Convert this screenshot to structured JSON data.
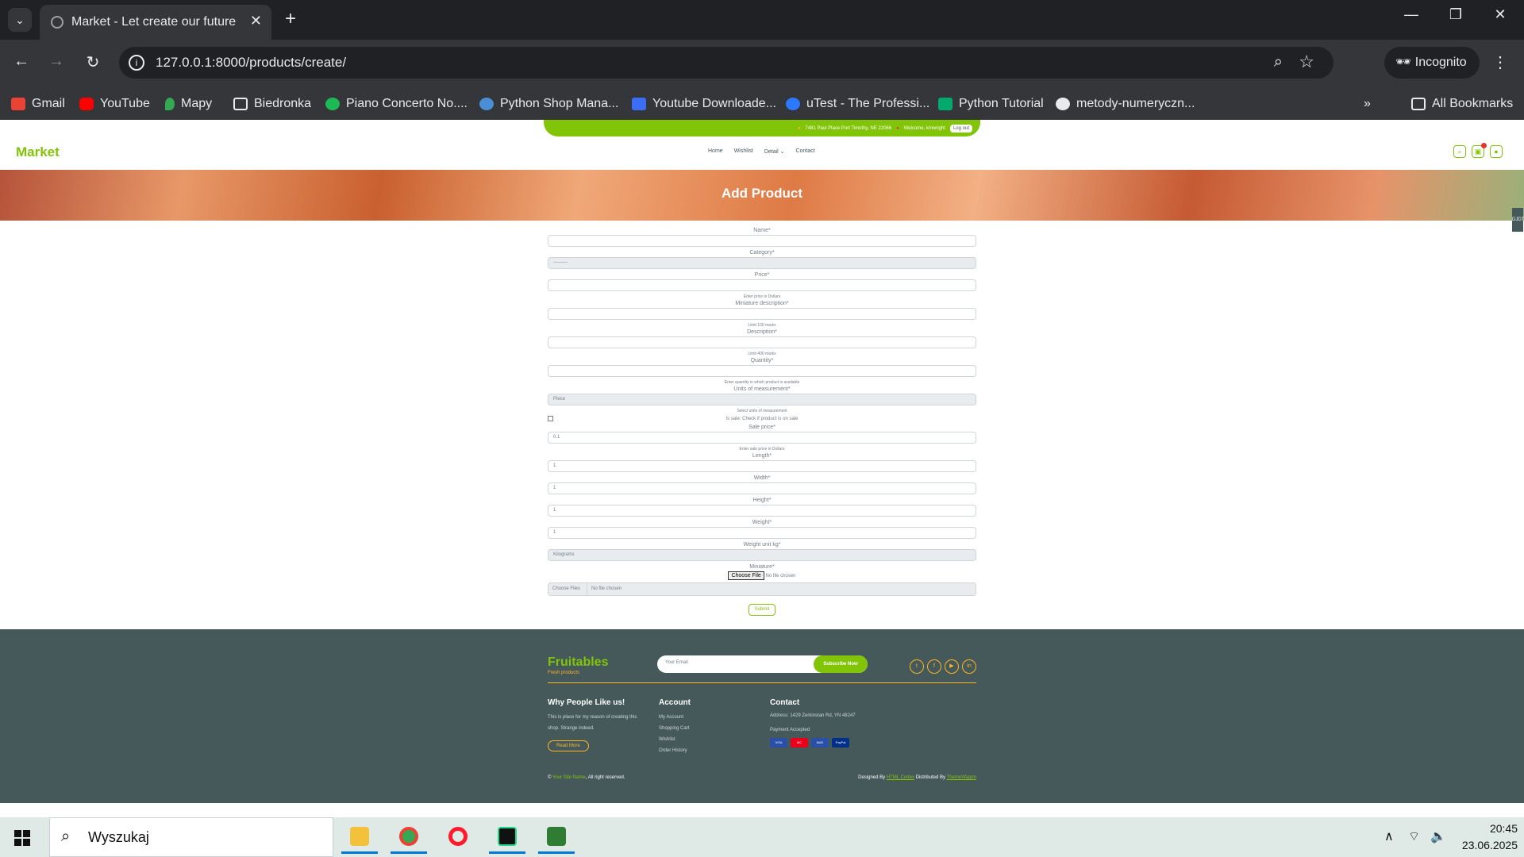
{
  "browser": {
    "tab_title": "Market - Let create our future",
    "url": "127.0.0.1:8000/products/create/",
    "incognito_label": "Incognito",
    "bookmarks": [
      "Gmail",
      "YouTube",
      "Mapy",
      "Biedronka",
      "Piano Concerto No....",
      "Python Shop Mana...",
      "Youtube Downloade...",
      "uTest - The Professi...",
      "Python Tutorial",
      "metody-numeryczn..."
    ],
    "all_bookmarks": "All Bookmarks"
  },
  "site": {
    "topbar_address": "7481 Paul Place Port Timothy, NE 22066",
    "topbar_welcome": "Welcome, kmwright",
    "logout": "Log out",
    "brand": "Market",
    "menu": [
      "Home",
      "Wishlist",
      "Detail",
      "Contact"
    ],
    "hero_title": "Add Product",
    "side_tab": "DJDT"
  },
  "form": {
    "name_label": "Name*",
    "category_label": "Category*",
    "category_value": "---------",
    "price_label": "Price*",
    "price_help": "Enter price in Dollars",
    "mini_desc_label": "Miniature description*",
    "mini_desc_help": "Limit 100 marks",
    "desc_label": "Description*",
    "desc_help": "Limit 400 marks",
    "quantity_label": "Quantity*",
    "quantity_help": "Enter quantity in which product is available",
    "units_label": "Units of measurement*",
    "units_value": "Piece",
    "units_help": "Select units of measurement",
    "sale_check": "Is sale: Check if product is on sale",
    "sale_price_label": "Sale price*",
    "sale_price_value": "0.1",
    "sale_price_help": "Enter sale price in Dollars",
    "length_label": "Length*",
    "length_value": "1",
    "width_label": "Width*",
    "width_value": "1",
    "height_label": "Height*",
    "height_value": "1",
    "weight_label": "Weight*",
    "weight_value": "1",
    "weight_unit_label": "Weight unit kg*",
    "weight_unit_value": "Kilograms",
    "miniature_label": "Miniature*",
    "choose_file": "Choose File",
    "no_file": "No file chosen",
    "choose_files": "Choose Files",
    "no_files": "No file chosen",
    "submit": "Submit"
  },
  "footer": {
    "brand": "Fruitables",
    "tagline": "Fresh products",
    "email_placeholder": "Your Email",
    "subscribe": "Subscribe Now",
    "why_title": "Why People Like us!",
    "why_text": "This is place for my reason of creating this shop. Strange indeed.",
    "read_more": "Read More",
    "account_title": "Account",
    "account_links": [
      "My Account",
      "Shopping Cart",
      "Wishlist",
      "Order History"
    ],
    "contact_title": "Contact",
    "address": "Address: 1429 Zerkinstan Rd, YN 48247",
    "payment_label": "Payment Accepted",
    "payments": [
      "VISA",
      "MC",
      "MAE",
      "PayPal"
    ],
    "copyright_site": "Your Site Name",
    "copyright_rest": ", All right reserved.",
    "designed_by": "Designed By",
    "designer": "HTML Codex",
    "distributed_by": "Distributed By",
    "distributor": "ThemeWagon"
  },
  "taskbar": {
    "search_placeholder": "Wyszukaj",
    "time": "20:45",
    "date": "23.06.2025"
  },
  "colors": {
    "accent": "#81c408",
    "footer_bg": "#45595b",
    "secondary": "#ffb524"
  }
}
